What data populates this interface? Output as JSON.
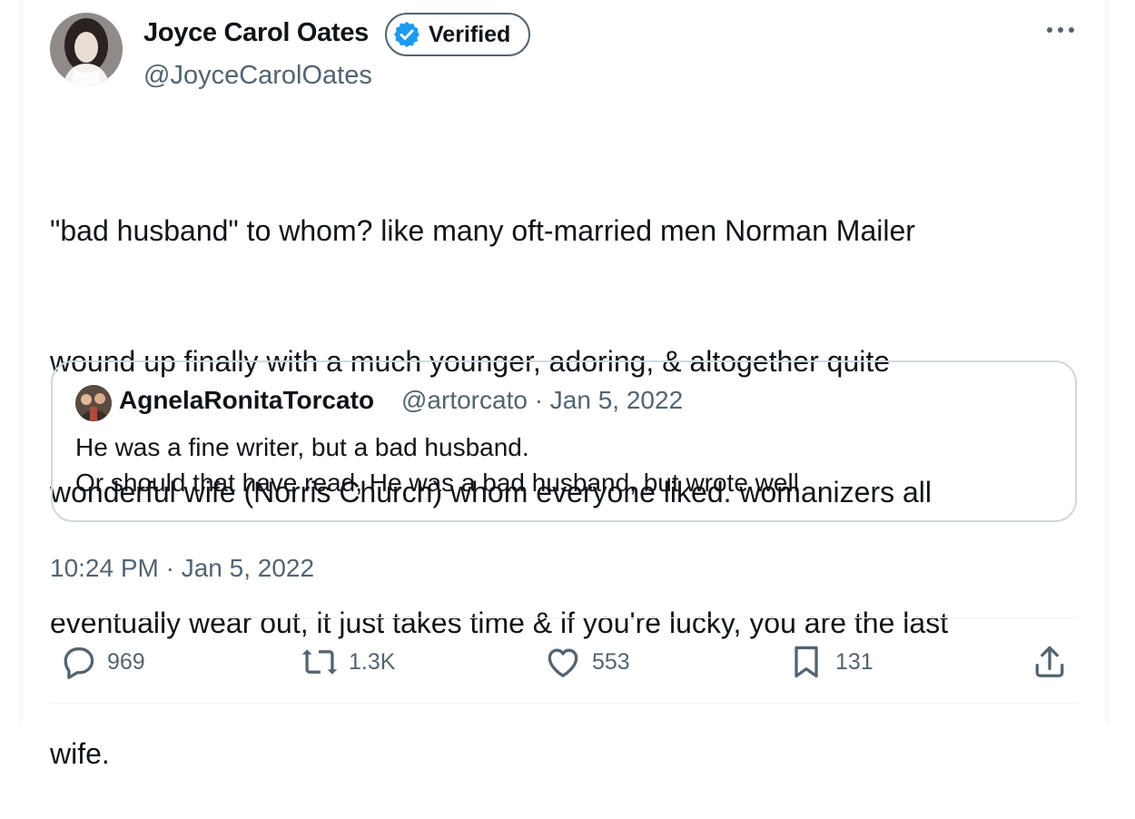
{
  "author": {
    "name": "Joyce Carol Oates",
    "badge": "Verified",
    "handle": "@JoyceCarolOates"
  },
  "tweet": {
    "text_lines": [
      "\"bad husband\" to whom? like many oft-married men Norman Mailer",
      "wound up finally with a much younger, adoring, & altogether quite",
      "wonderful wife (Norris Church) whom everyone liked. womanizers all",
      "eventually wear out, it just takes time & if you're lucky, you are the last",
      "wife."
    ],
    "timestamp": "10:24 PM · Jan 5, 2022"
  },
  "quoted": {
    "name": "AgnelaRonitaTorcato",
    "meta": "@artorcato · Jan 5, 2022",
    "lines": [
      "He was a fine writer, but a bad husband.",
      "Or should that have read, He was a bad husband, but wrote well"
    ]
  },
  "actions": {
    "replies": "969",
    "reposts": "1.3K",
    "likes": "553",
    "bookmarks": "131"
  },
  "icons": {
    "verified": "verified-badge-icon",
    "more": "more-icon",
    "reply": "reply-icon",
    "repost": "repost-icon",
    "like": "heart-icon",
    "bookmark": "bookmark-icon",
    "share": "share-icon"
  },
  "colors": {
    "verified_blue": "#1d9bf0",
    "secondary_text": "#536471",
    "border": "#cfd9de"
  }
}
